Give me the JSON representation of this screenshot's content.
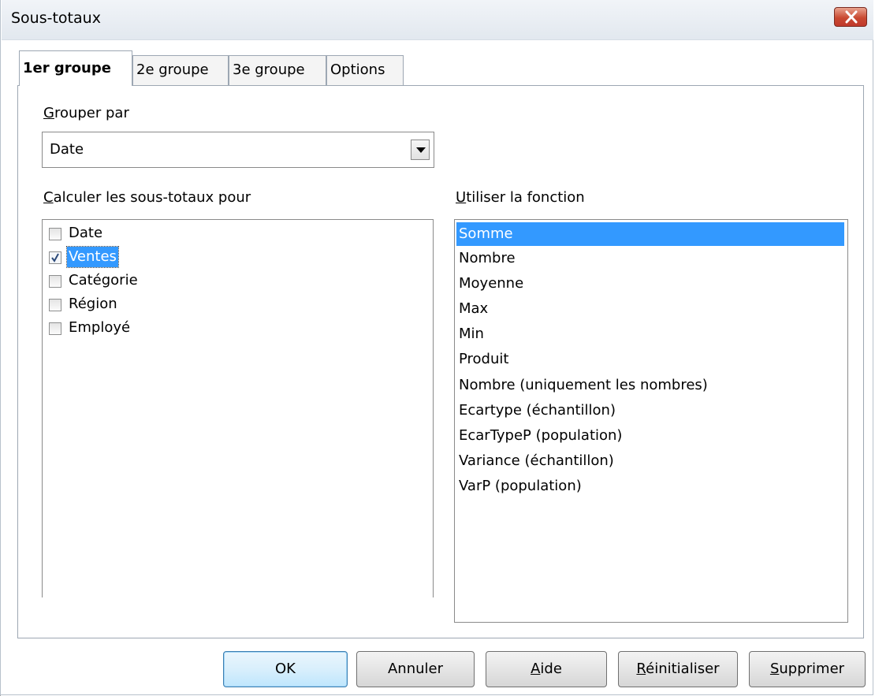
{
  "window": {
    "title": "Sous-totaux"
  },
  "tabs": [
    {
      "label": "1er groupe",
      "active": true
    },
    {
      "label": "2e groupe",
      "active": false
    },
    {
      "label": "3e groupe",
      "active": false
    },
    {
      "label": "Options",
      "active": false
    }
  ],
  "group_by": {
    "label_access": "G",
    "label_rest": "rouper par",
    "value": "Date"
  },
  "subtotals_for": {
    "label_access": "C",
    "label_rest": "alculer les sous-totaux pour",
    "fields": [
      {
        "label": "Date",
        "checked": false,
        "selected": false
      },
      {
        "label": "Ventes",
        "checked": true,
        "selected": true
      },
      {
        "label": "Catégorie",
        "checked": false,
        "selected": false
      },
      {
        "label": "Région",
        "checked": false,
        "selected": false
      },
      {
        "label": "Employé",
        "checked": false,
        "selected": false
      }
    ]
  },
  "use_function": {
    "label_access": "U",
    "label_rest": "tiliser la fonction",
    "functions": [
      {
        "label": "Somme",
        "selected": true
      },
      {
        "label": "Nombre",
        "selected": false
      },
      {
        "label": "Moyenne",
        "selected": false
      },
      {
        "label": "Max",
        "selected": false
      },
      {
        "label": "Min",
        "selected": false
      },
      {
        "label": "Produit",
        "selected": false
      },
      {
        "label": "Nombre (uniquement les nombres)",
        "selected": false
      },
      {
        "label": "Ecartype (échantillon)",
        "selected": false
      },
      {
        "label": "EcarTypeP (population)",
        "selected": false
      },
      {
        "label": "Variance (échantillon)",
        "selected": false
      },
      {
        "label": "VarP (population)",
        "selected": false
      }
    ]
  },
  "buttons": {
    "ok": "OK",
    "cancel": "Annuler",
    "help_access": "A",
    "help_rest": "ide",
    "reset_access": "R",
    "reset_rest": "éinitialiser",
    "delete_access": "S",
    "delete_rest": "upprimer"
  },
  "colors": {
    "selection": "#3399ff",
    "close_button": "#c94a32"
  }
}
